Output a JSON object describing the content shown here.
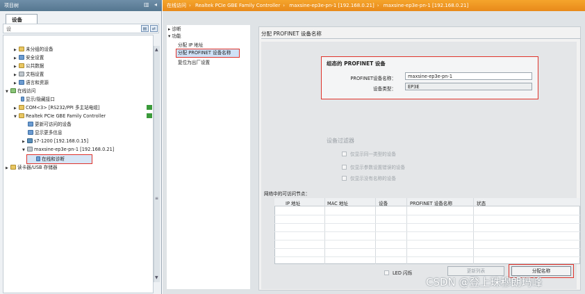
{
  "left_panel": {
    "title": "项目树",
    "device_tab": "设备",
    "toolbar_hint": "设",
    "tree": [
      {
        "label": "未分组的设备",
        "icon": "folder-icon"
      },
      {
        "label": "安全设置",
        "icon": "shield-icon"
      },
      {
        "label": "公共数据",
        "icon": "folder-icon"
      },
      {
        "label": "文档设置",
        "icon": "document-icon"
      },
      {
        "label": "语言和资源",
        "icon": "globe-icon"
      },
      {
        "label": "在线访问",
        "icon": "network-icon"
      },
      {
        "label": "显示/隐藏接口",
        "icon": "interface-icon"
      },
      {
        "label": "COM<3> [RS232/PPI 多主站电缆]",
        "icon": "cable-icon"
      },
      {
        "label": "Realtek PCIe GBE Family Controller",
        "icon": "ethernet-icon"
      },
      {
        "label": "更新可访问的设备",
        "icon": "refresh-icon"
      },
      {
        "label": "显示更多信息",
        "icon": "info-icon"
      },
      {
        "label": "s7-1200 [192.168.0.15]",
        "icon": "plc-icon"
      },
      {
        "label": "maxsine-ep3e-pn-1 [192.168.0.21]",
        "icon": "drive-icon"
      },
      {
        "label": "在线和诊断",
        "icon": "diagnostics-icon"
      },
      {
        "label": "读卡器/USB 存储器",
        "icon": "usb-icon"
      }
    ]
  },
  "breadcrumb": [
    "在线访问",
    "Realtek PCIe GBE Family Controller",
    "maxsine-ep3e-pn-1 [192.168.0.21]",
    "maxsine-ep3e-pn-1 [192.168.0.21]"
  ],
  "nav": {
    "items": [
      "诊断",
      "功能",
      "分配 IP 地址",
      "分配 PROFINET 设备名称",
      "复位为出厂设置"
    ]
  },
  "content": {
    "title": "分配 PROFINET 设备名称",
    "config_title": "组态的 PROFINET 设备",
    "device_name_label": "PROFINET设备名称：",
    "device_name_value": "maxsine-ep3e-pn-1",
    "device_type_label": "设备类型：",
    "device_type_value": "EP3E",
    "filter_title": "设备过滤器",
    "filters": [
      "仅显示同一类型的设备",
      "仅显示参数设置错误的设备",
      "仅显示没有名称的设备"
    ],
    "nodes_title": "网络中的可访问节点：",
    "columns": [
      "IP 地址",
      "MAC 地址",
      "设备",
      "PROFINET 设备名称",
      "状态"
    ],
    "led_label": "LED 闪烁",
    "update_button": "更新列表",
    "assign_button": "分配名称"
  },
  "watermark": "CSDN @登上珠穆朗玛峰"
}
